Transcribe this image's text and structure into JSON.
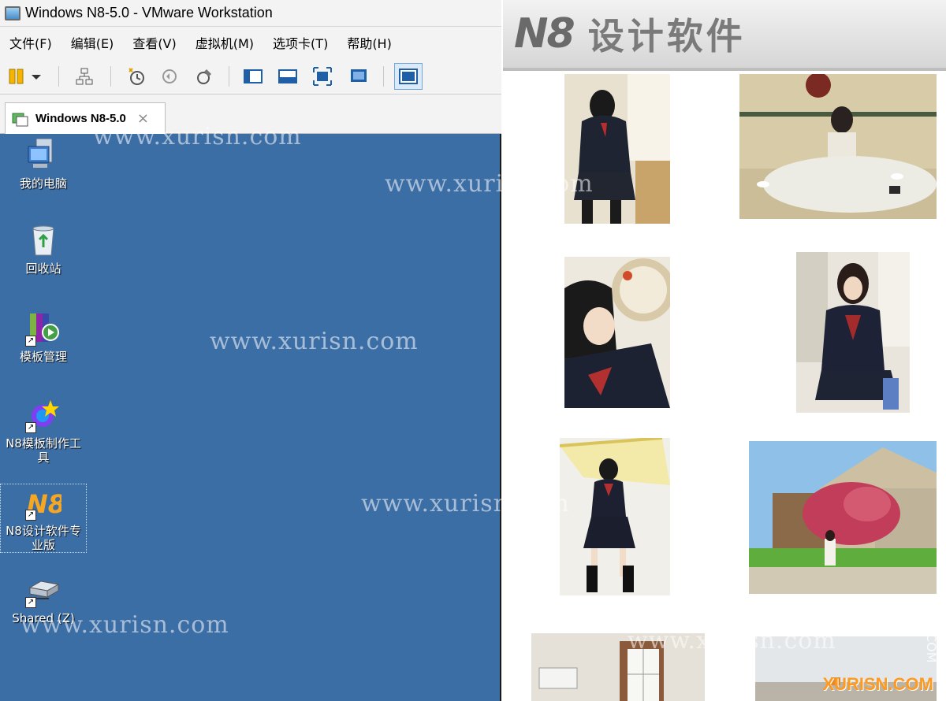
{
  "window": {
    "title": "Windows N8-5.0 - VMware Workstation",
    "menu": [
      "文件(F)",
      "编辑(E)",
      "查看(V)",
      "虚拟机(M)",
      "选项卡(T)",
      "帮助(H)"
    ],
    "tab": {
      "title": "Windows N8-5.0",
      "close": "×"
    }
  },
  "toolbar": {
    "icons": [
      "pause-icon",
      "dropdown-icon",
      "network-icon",
      "snapshot-take-icon",
      "snapshot-revert-icon",
      "snapshot-manager-icon",
      "sidebar-view-icon",
      "console-view-icon",
      "fullscreen-icon",
      "unity-icon",
      "thumbnail-view-icon"
    ]
  },
  "desktop": {
    "icons": [
      {
        "label": "我的电脑",
        "icon": "my-computer-icon"
      },
      {
        "label": "回收站",
        "icon": "recycle-bin-icon"
      },
      {
        "label": "模板管理",
        "icon": "template-manager-icon"
      },
      {
        "label": "N8模板制作工具",
        "icon": "template-maker-icon"
      },
      {
        "label": "N8设计软件专业版",
        "icon": "n8-design-icon"
      },
      {
        "label": "Shared (Z)",
        "icon": "shared-drive-icon"
      }
    ]
  },
  "site": {
    "logo_mark": "N8",
    "logo_text": "设计软件"
  },
  "watermarks": {
    "text": "www.xurisn.com",
    "corner": "XURISN.COM",
    "vertical": "COM"
  },
  "colors": {
    "desktop": "#3c6ea6",
    "chrome": "#f3f3f3",
    "corner_watermark": "#ff9a1f"
  }
}
